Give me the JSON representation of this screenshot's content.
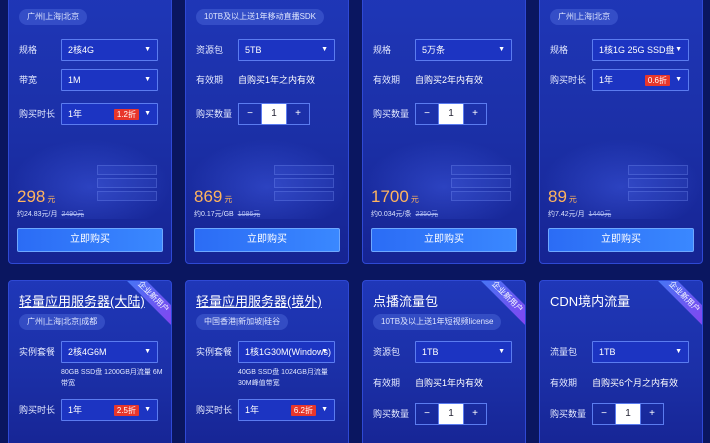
{
  "cards_top": [
    {
      "tag": "广州|上海|北京",
      "rows": [
        {
          "label": "规格",
          "value": "2核4G",
          "type": "select"
        },
        {
          "label": "带宽",
          "value": "1M",
          "type": "select"
        },
        {
          "label": "购买时长",
          "value": "1年",
          "type": "select",
          "badge": "1.2折"
        }
      ],
      "price": "298",
      "price_unit": "元",
      "sub": "约24.83元/月",
      "orig": "2490元",
      "buy": "立即购买"
    },
    {
      "tag": "10TB及以上送1年移动直播SDK",
      "rows": [
        {
          "label": "资源包",
          "value": "5TB",
          "type": "select"
        },
        {
          "label": "有效期",
          "value": "自购买1年之内有效",
          "type": "text"
        },
        {
          "label": "购买数量",
          "value": "1",
          "type": "stepper"
        }
      ],
      "price": "869",
      "price_unit": "元",
      "sub": "约0.17元/GB",
      "orig": "1086元",
      "buy": "立即购买"
    },
    {
      "tag": "",
      "rows": [
        {
          "label": "规格",
          "value": "5万条",
          "type": "select"
        },
        {
          "label": "有效期",
          "value": "自购买2年内有效",
          "type": "text"
        },
        {
          "label": "购买数量",
          "value": "1",
          "type": "stepper"
        }
      ],
      "price": "1700",
      "price_unit": "元",
      "sub": "约0.034元/条",
      "orig": "2350元",
      "buy": "立即购买"
    },
    {
      "tag": "广州|上海|北京",
      "rows": [
        {
          "label": "规格",
          "value": "1核1G 25G SSD盘",
          "type": "select"
        },
        {
          "label": "购买时长",
          "value": "1年",
          "type": "select",
          "badge": "0.6折"
        }
      ],
      "price": "89",
      "price_unit": "元",
      "sub": "约7.42元/月",
      "orig": "1440元",
      "buy": "立即购买"
    }
  ],
  "cards_bottom": [
    {
      "title": "轻量应用服务器(大陆)",
      "ribbon": "企业新用户",
      "tag": "广州|上海|北京|成都",
      "plan_label": "实例套餐",
      "plan_value": "2核4G6M",
      "plan_note": "80GB SSD盘 1200GB月流量 6M带宽",
      "dur_label": "购买时长",
      "dur_value": "1年",
      "dur_badge": "2.5折"
    },
    {
      "title": "轻量应用服务器(境外)",
      "ribbon": "",
      "tag": "中国香港|新加坡|硅谷",
      "plan_label": "实例套餐",
      "plan_value": "1核1G30M(Windows)",
      "plan_note": "40GB SSD盘 1024GB月流量 30M峰值带宽",
      "dur_label": "购买时长",
      "dur_value": "1年",
      "dur_badge": "6.2折"
    },
    {
      "title": "点播流量包",
      "ribbon": "企业新用户",
      "tag": "10TB及以上送1年短视频license",
      "r1_label": "资源包",
      "r1_value": "1TB",
      "r2_label": "有效期",
      "r2_value": "自购买1年内有效",
      "r3_label": "购买数量",
      "r3_value": "1"
    },
    {
      "title": "CDN境内流量",
      "ribbon": "企业新用户",
      "r1_label": "流量包",
      "r1_value": "1TB",
      "r2_label": "有效期",
      "r2_value": "自购买6个月之内有效",
      "r3_label": "购买数量",
      "r3_value": "1"
    }
  ],
  "colors": {
    "accent": "#2b6cf5",
    "price": "#ffb45e",
    "badge": "#e8362c"
  }
}
